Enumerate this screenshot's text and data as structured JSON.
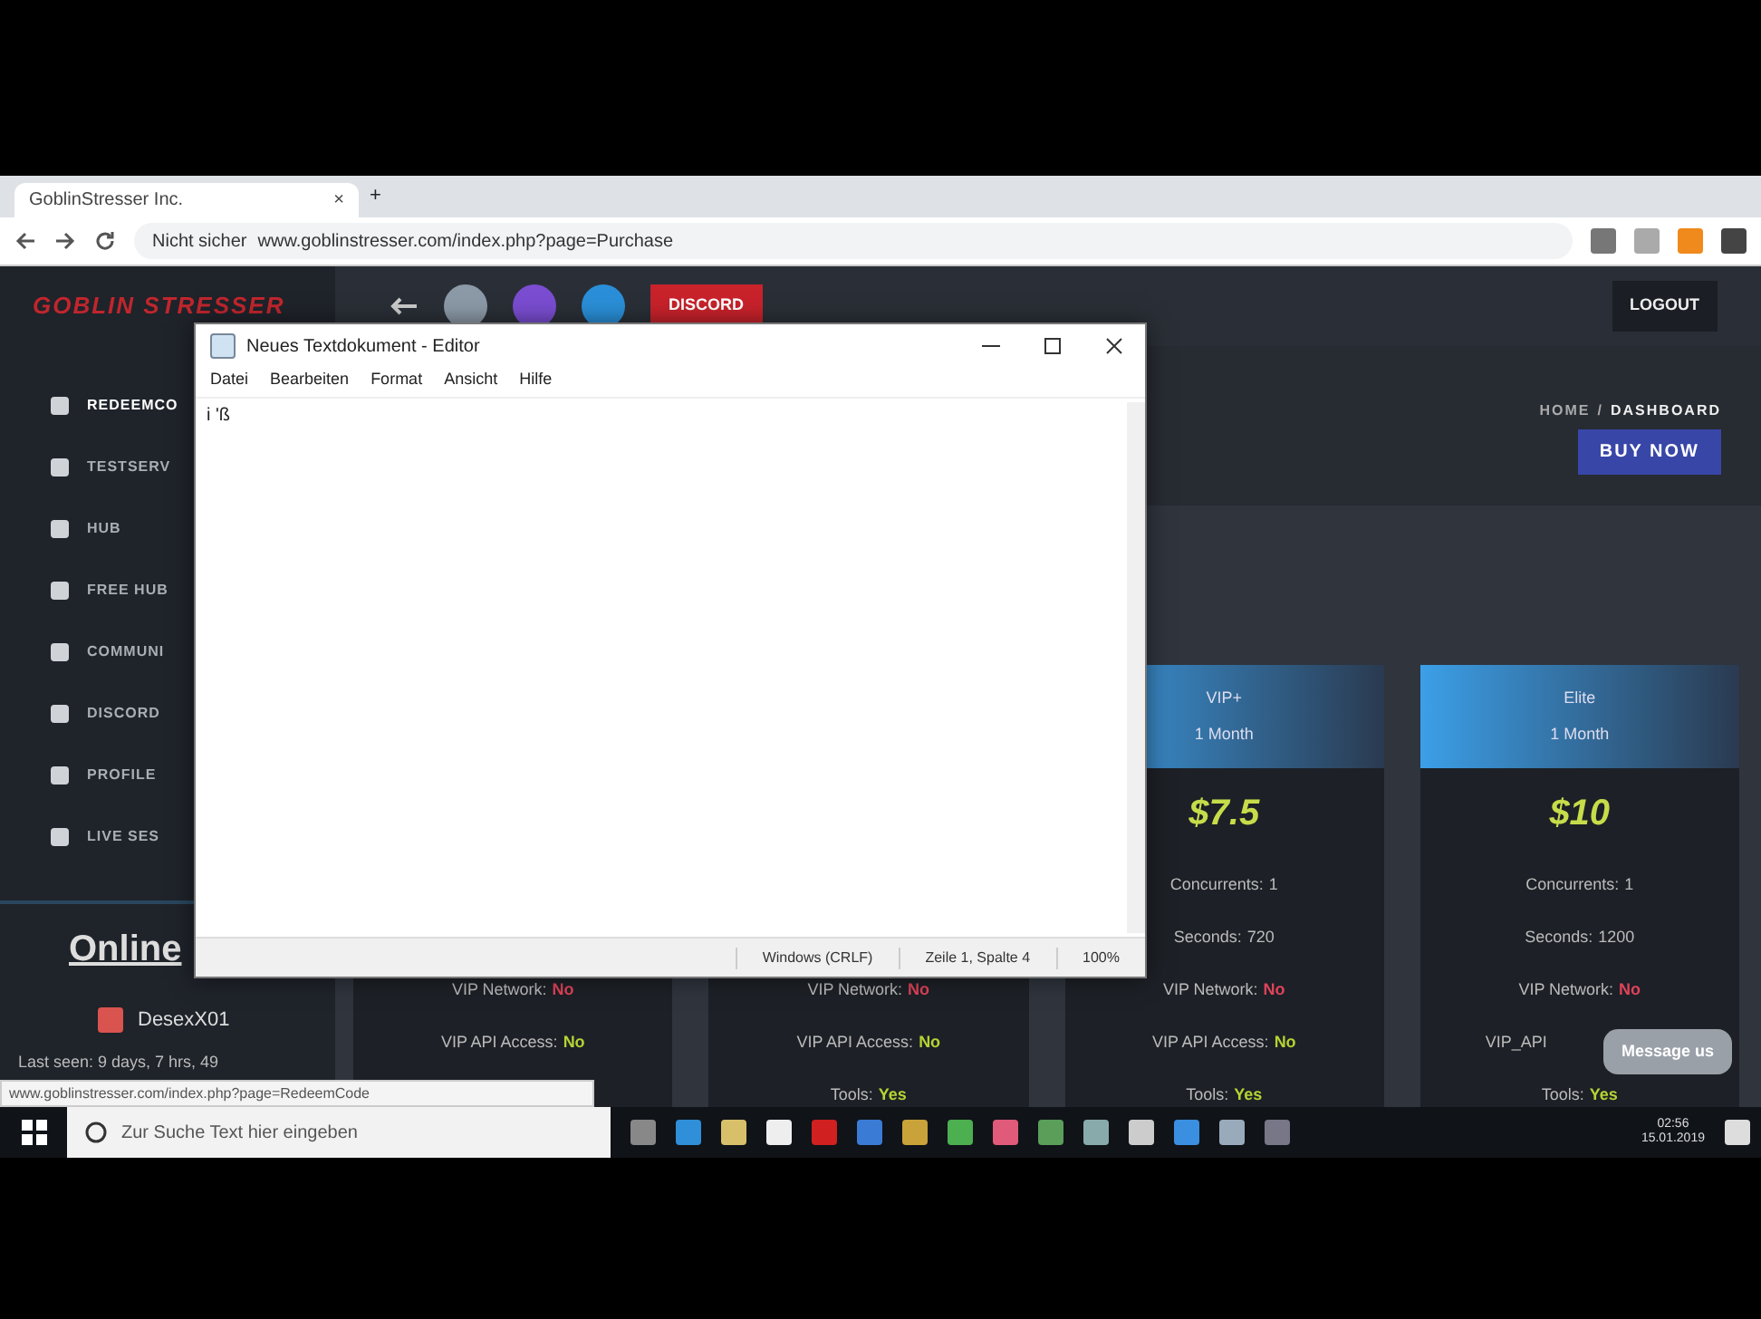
{
  "browser": {
    "tab_title": "GoblinStresser Inc.",
    "tab_close": "×",
    "new_tab": "+",
    "address_security": "Nicht sicher",
    "address_url": "www.goblinstresser.com/index.php?page=Purchase"
  },
  "site": {
    "logo": "GOBLIN STRESSER",
    "header_button": "DISCORD",
    "logout": "LOGOUT",
    "sidebar": [
      {
        "label": "REDEEMCO",
        "selected": true
      },
      {
        "label": "TESTSERV",
        "selected": false
      },
      {
        "label": "HUB",
        "selected": false
      },
      {
        "label": "FREE HUB",
        "selected": false
      },
      {
        "label": "COMMUNI",
        "selected": false
      },
      {
        "label": "DISCORD",
        "selected": false
      },
      {
        "label": "PROFILE",
        "selected": false
      },
      {
        "label": "LIVE SES",
        "selected": false
      }
    ],
    "online": {
      "heading": "Online",
      "user": "DesexX01",
      "last_seen": "Last seen: 9 days, 7 hrs, 49"
    },
    "breadcrumb": {
      "home": "HOME",
      "separator": "/",
      "current": "DASHBOARD"
    },
    "buy_now": "BUY NOW",
    "plans": [
      {
        "features": [
          {
            "label": "VIP Network:",
            "value": "No",
            "color": "#e0435a"
          },
          {
            "label": "VIP API Access:",
            "value": "No",
            "color": "#b5d334"
          }
        ]
      },
      {
        "features": [
          {
            "label": "VIP Network:",
            "value": "No",
            "color": "#e0435a"
          },
          {
            "label": "VIP API Access:",
            "value": "No",
            "color": "#b5d334"
          },
          {
            "label": "Tools:",
            "value": "Yes",
            "color": "#b5d334"
          }
        ]
      },
      {
        "name": "VIP+",
        "duration": "1 Month",
        "price": "$7.5",
        "features": [
          {
            "label": "Concurrents:",
            "value": "1"
          },
          {
            "label": "Seconds:",
            "value": "720"
          },
          {
            "label": "VIP Network:",
            "value": "No",
            "color": "#e0435a"
          },
          {
            "label": "VIP API Access:",
            "value": "No",
            "color": "#b5d334"
          },
          {
            "label": "Tools:",
            "value": "Yes",
            "color": "#b5d334"
          }
        ]
      },
      {
        "name": "Elite",
        "duration": "1 Month",
        "price": "$10",
        "features": [
          {
            "label": "Concurrents:",
            "value": "1"
          },
          {
            "label": "Seconds:",
            "value": "1200"
          },
          {
            "label": "VIP Network:",
            "value": "No",
            "color": "#e0435a"
          },
          {
            "label": "VIP_API"
          },
          {
            "label": "Tools:",
            "value": "Yes",
            "color": "#b5d334"
          }
        ]
      }
    ],
    "message_button": "Message us",
    "status_link": "www.goblinstresser.com/index.php?page=RedeemCode"
  },
  "notepad": {
    "title": "Neues Textdokument - Editor",
    "menu": [
      "Datei",
      "Bearbeiten",
      "Format",
      "Ansicht",
      "Hilfe"
    ],
    "content": "i 'ß",
    "status": [
      "Windows (CRLF)",
      "Zeile 1, Spalte 4",
      "100%"
    ]
  },
  "taskbar": {
    "search_placeholder": "Zur Suche Text hier eingeben",
    "time": "02:56",
    "date": "15.01.2019"
  }
}
